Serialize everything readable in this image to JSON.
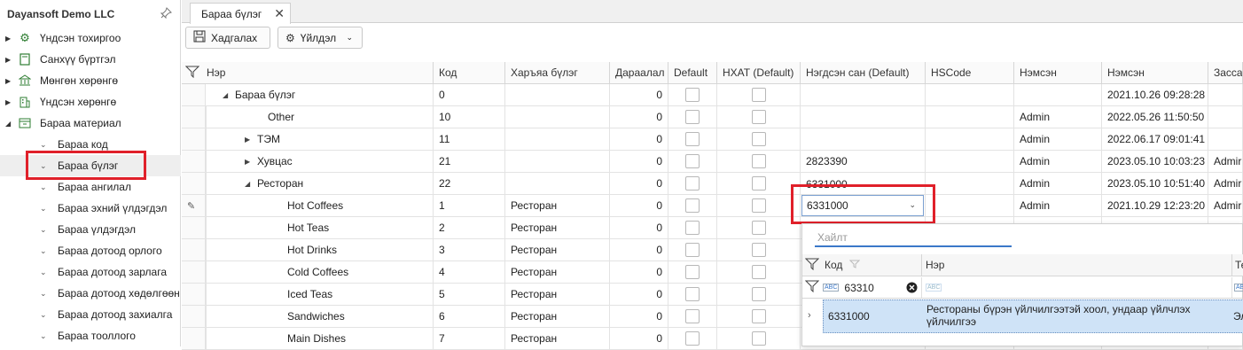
{
  "company": "Dayansoft Demo LLC",
  "nav": [
    {
      "label": "Үндсэн тохиргоо",
      "icon": "gear-icon"
    },
    {
      "label": "Санхүү бүртгэл",
      "icon": "book-icon"
    },
    {
      "label": "Мөнгөн хөрөнгө",
      "icon": "bank-icon"
    },
    {
      "label": "Үндсэн хөрөнгө",
      "icon": "building-icon"
    },
    {
      "label": "Бараа материал",
      "icon": "inventory-icon"
    }
  ],
  "subnav": [
    "Бараа код",
    "Бараа бүлэг",
    "Бараа ангилал",
    "Бараа эхний үлдэгдэл",
    "Бараа үлдэгдэл",
    "Бараа дотоод орлого",
    "Бараа дотоод зарлага",
    "Бараа дотоод хөдөлгөөн",
    "Бараа дотоод захиалга",
    "Бараа тооллого"
  ],
  "tab": {
    "label": "Бараа бүлэг"
  },
  "toolbar": {
    "save": "Хадгалах",
    "action": "Үйлдэл"
  },
  "columns": [
    "Нэр",
    "Код",
    "Харъяа бүлэг",
    "Дараалал",
    "Default",
    "НХАТ (Default)",
    "Нэгдсэн сан (Default)",
    "HSCode",
    "Нэмсэн",
    "Нэмсэн",
    "Засса"
  ],
  "rows": [
    {
      "name": "Бараа бүлэг",
      "code": "0",
      "parent": "",
      "order": "0",
      "fund": "",
      "by": "",
      "date": "2021.10.26 09:28:28",
      "edited": ""
    },
    {
      "name": "Other",
      "code": "10",
      "parent": "",
      "order": "0",
      "fund": "",
      "by": "Admin",
      "date": "2022.05.26 11:50:50",
      "edited": ""
    },
    {
      "name": "ТЭМ",
      "code": "11",
      "parent": "",
      "order": "0",
      "fund": "",
      "by": "Admin",
      "date": "2022.06.17 09:01:41",
      "edited": ""
    },
    {
      "name": "Хувцас",
      "code": "21",
      "parent": "",
      "order": "0",
      "fund": "2823390",
      "by": "Admin",
      "date": "2023.05.10 10:03:23",
      "edited": "Admir"
    },
    {
      "name": "Ресторан",
      "code": "22",
      "parent": "",
      "order": "0",
      "fund": "6331000",
      "by": "Admin",
      "date": "2023.05.10 10:51:40",
      "edited": "Admir"
    },
    {
      "name": "Hot Coffees",
      "code": "1",
      "parent": "Ресторан",
      "order": "0",
      "fund": "",
      "by": "Admin",
      "date": "2021.10.29 12:23:20",
      "edited": "Admir"
    },
    {
      "name": "Hot Teas",
      "code": "2",
      "parent": "Ресторан",
      "order": "0",
      "fund": "",
      "by": "",
      "date": "",
      "edited": ""
    },
    {
      "name": "Hot Drinks",
      "code": "3",
      "parent": "Ресторан",
      "order": "0",
      "fund": "",
      "by": "",
      "date": "",
      "edited": ""
    },
    {
      "name": "Cold Coffees",
      "code": "4",
      "parent": "Ресторан",
      "order": "0",
      "fund": "",
      "by": "",
      "date": "",
      "edited": ""
    },
    {
      "name": "Iced Teas",
      "code": "5",
      "parent": "Ресторан",
      "order": "0",
      "fund": "",
      "by": "",
      "date": "",
      "edited": ""
    },
    {
      "name": "Sandwiches",
      "code": "6",
      "parent": "Ресторан",
      "order": "0",
      "fund": "",
      "by": "",
      "date": "",
      "edited": ""
    },
    {
      "name": "Main Dishes",
      "code": "7",
      "parent": "Ресторан",
      "order": "0",
      "fund": "",
      "by": "",
      "date": "",
      "edited": ""
    }
  ],
  "combo": {
    "value": "6331000"
  },
  "popup": {
    "search_placeholder": "Хайлт",
    "col_code": "Код",
    "col_name": "Нэр",
    "col_third": "Те",
    "filter_value": "63310",
    "abc": "ABC",
    "row_code": "6331000",
    "row_name": "Рестораны бүрэн үйлчилгээтэй хоол, ундаар үйлчлэх үйлчилгээ",
    "row_third": "Эл"
  }
}
